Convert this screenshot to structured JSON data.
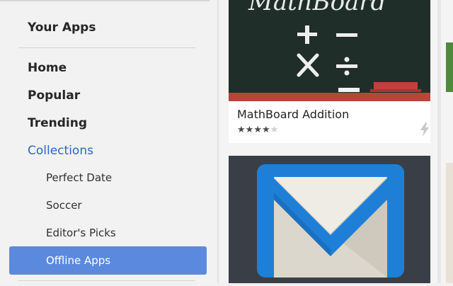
{
  "sidebar": {
    "your_apps": "Your Apps",
    "nav": [
      {
        "label": "Home"
      },
      {
        "label": "Popular"
      },
      {
        "label": "Trending"
      },
      {
        "label": "Collections"
      }
    ],
    "collections": [
      {
        "label": "Perfect Date"
      },
      {
        "label": "Soccer"
      },
      {
        "label": "Editor's Picks"
      },
      {
        "label": "Offline Apps",
        "selected": true
      }
    ]
  },
  "cards": [
    {
      "title": "MathBoard Addition",
      "rating": 4,
      "rating_max": 5,
      "icon": "lightning-bolt-icon",
      "image_text": "MathBoard"
    },
    {
      "title": "",
      "icon": "gmail-offline-envelope-icon"
    }
  ],
  "colors": {
    "accent": "#2b66c7",
    "selected_bg": "#5b89de",
    "chalkboard": "#1f2e28"
  }
}
